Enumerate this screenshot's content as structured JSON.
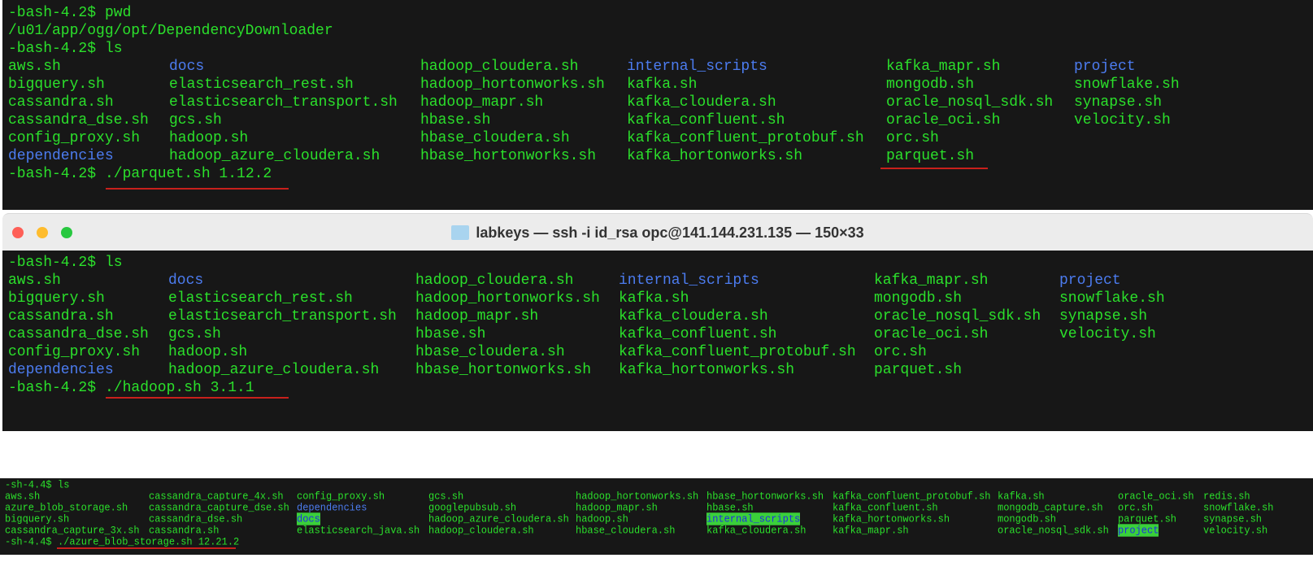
{
  "terminal1": {
    "lines": [
      {
        "prompt": "-bash-4.2$ ",
        "cmd": "pwd"
      },
      {
        "output": "/u01/app/ogg/opt/DependencyDownloader"
      },
      {
        "prompt": "-bash-4.2$ ",
        "cmd": "ls"
      }
    ],
    "columns": [
      [
        "aws.sh",
        "bigquery.sh",
        "cassandra.sh",
        "cassandra_dse.sh",
        "config_proxy.sh",
        {
          "t": "dependencies",
          "k": "dir"
        }
      ],
      [
        {
          "t": "docs",
          "k": "dir"
        },
        "elasticsearch_rest.sh",
        "elasticsearch_transport.sh",
        "gcs.sh",
        "hadoop.sh",
        "hadoop_azure_cloudera.sh"
      ],
      [
        "hadoop_cloudera.sh",
        "hadoop_hortonworks.sh",
        "hadoop_mapr.sh",
        "hbase.sh",
        "hbase_cloudera.sh",
        "hbase_hortonworks.sh"
      ],
      [
        {
          "t": "internal_scripts",
          "k": "dir"
        },
        "kafka.sh",
        "kafka_cloudera.sh",
        "kafka_confluent.sh",
        "kafka_confluent_protobuf.sh",
        "kafka_hortonworks.sh"
      ],
      [
        "kafka_mapr.sh",
        "mongodb.sh",
        "oracle_nosql_sdk.sh",
        "oracle_oci.sh",
        "orc.sh",
        "parquet.sh"
      ],
      [
        {
          "t": "project",
          "k": "dir"
        },
        "snowflake.sh",
        "synapse.sh",
        "velocity.sh"
      ]
    ],
    "final": {
      "prompt": "-bash-4.2$ ",
      "cmd": "./parquet.sh 1.12.2"
    }
  },
  "window": {
    "title": "labkeys — ssh -i id_rsa opc@141.144.231.135 — 150×33",
    "icon": "folder-icon"
  },
  "terminal2": {
    "lines": [
      {
        "prompt": "-bash-4.2$ ",
        "cmd": "ls"
      }
    ],
    "columns": [
      [
        "aws.sh",
        "bigquery.sh",
        "cassandra.sh",
        "cassandra_dse.sh",
        "config_proxy.sh",
        {
          "t": "dependencies",
          "k": "dir"
        }
      ],
      [
        {
          "t": "docs",
          "k": "dir"
        },
        "elasticsearch_rest.sh",
        "elasticsearch_transport.sh",
        "gcs.sh",
        "hadoop.sh",
        "hadoop_azure_cloudera.sh"
      ],
      [
        "hadoop_cloudera.sh",
        "hadoop_hortonworks.sh",
        "hadoop_mapr.sh",
        "hbase.sh",
        "hbase_cloudera.sh",
        "hbase_hortonworks.sh"
      ],
      [
        {
          "t": "internal_scripts",
          "k": "dir"
        },
        "kafka.sh",
        "kafka_cloudera.sh",
        "kafka_confluent.sh",
        "kafka_confluent_protobuf.sh",
        "kafka_hortonworks.sh"
      ],
      [
        "kafka_mapr.sh",
        "mongodb.sh",
        "oracle_nosql_sdk.sh",
        "oracle_oci.sh",
        "orc.sh",
        "parquet.sh"
      ],
      [
        {
          "t": "project",
          "k": "dir"
        },
        "snowflake.sh",
        "synapse.sh",
        "velocity.sh"
      ]
    ],
    "final": {
      "prompt": "-bash-4.2$ ",
      "cmd": "./hadoop.sh 3.1.1"
    }
  },
  "terminal3": {
    "lines": [
      {
        "prompt": "-sh-4.4$ ",
        "cmd": "ls"
      }
    ],
    "columns": [
      [
        "aws.sh",
        "azure_blob_storage.sh",
        "bigquery.sh",
        "cassandra_capture_3x.sh"
      ],
      [
        "cassandra_capture_4x.sh",
        "cassandra_capture_dse.sh",
        "cassandra_dse.sh",
        "cassandra.sh"
      ],
      [
        "config_proxy.sh",
        {
          "t": "dependencies",
          "k": "dir"
        },
        {
          "t": "docs",
          "k": "hl"
        },
        "elasticsearch_java.sh"
      ],
      [
        "gcs.sh",
        "googlepubsub.sh",
        "hadoop_azure_cloudera.sh",
        "hadoop_cloudera.sh"
      ],
      [
        "hadoop_hortonworks.sh",
        "hadoop_mapr.sh",
        "hadoop.sh",
        "hbase_cloudera.sh"
      ],
      [
        "hbase_hortonworks.sh",
        "hbase.sh",
        {
          "t": "internal_scripts",
          "k": "hl"
        },
        "kafka_cloudera.sh"
      ],
      [
        "kafka_confluent_protobuf.sh",
        "kafka_confluent.sh",
        "kafka_hortonworks.sh",
        "kafka_mapr.sh"
      ],
      [
        "kafka.sh",
        "mongodb_capture.sh",
        "mongodb.sh",
        "oracle_nosql_sdk.sh"
      ],
      [
        "oracle_oci.sh",
        "orc.sh",
        "parquet.sh",
        {
          "t": "project",
          "k": "hl"
        }
      ],
      [
        "redis.sh",
        "snowflake.sh",
        "synapse.sh",
        "velocity.sh"
      ]
    ],
    "final": {
      "prompt": "-sh-4.4$ ",
      "cmd": "./azure_blob_storage.sh 12.21.2"
    }
  },
  "colors": {
    "text": "#2be02b",
    "dir": "#4c7cf0",
    "highlight": "#3ad03a",
    "underline": "#c8201c"
  }
}
